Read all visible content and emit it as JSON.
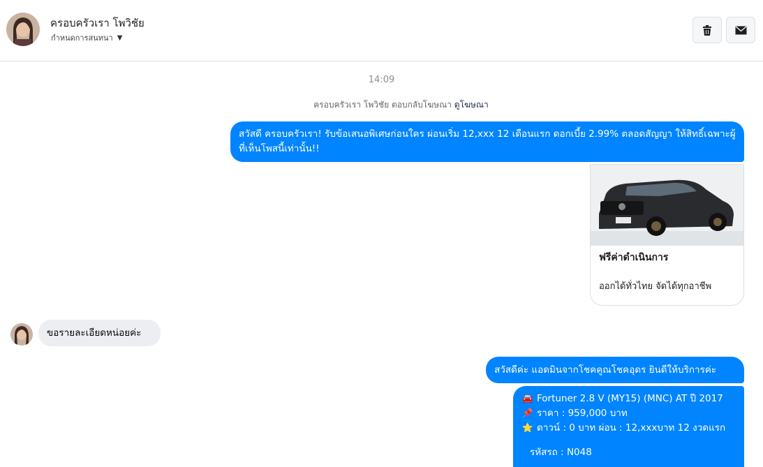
{
  "header": {
    "name": "ครอบครัวเรา โพวิชัย",
    "subtitle": "กำหนดการสนทนา",
    "delete_icon": "trash-icon",
    "mail_icon": "envelope-icon"
  },
  "conversation": {
    "timestamp": "14:09",
    "reply_note_prefix": "ครอบครัวเรา โพวิชัย ตอบกลับโฆษณา",
    "reply_note_link": "ดูโฆษณา",
    "messages": {
      "ad_text": "สวัสดี ครอบครัวเรา! รับข้อเสนอพิเศษก่อนใคร ผ่อนเริ่ม 12,xxx 12 เดือนแรก ดอกเบี้ย 2.99% ตลอดสัญญา ให้สิทธิ์เฉพาะผู้ที่เห็นโพสนี้เท่านั้น!!",
      "card_title": "ฟรีค่าดำเนินการ",
      "card_subtitle": "ออกได้ทั่วไทย จัดได้ทุกอาชีพ",
      "customer_message": "ขอรายละเอียดหน่อยค่ะ",
      "admin_greeting": "สวัสดีค่ะ แอดมินจากโชคคูณโชคอุดร ยินดีให้บริการค่ะ",
      "details": {
        "car_icon": "car-icon",
        "car": "Fortuner 2.8 V (MY15) (MNC) AT ปี 2017",
        "pin_icon": "pin-icon",
        "price": "ราคา : 959,000 บาท",
        "star_icon": "star-icon",
        "down": "ดาวน์ : 0 บาท ผ่อน : 12,xxxบาท 12 งวดแรก",
        "code": "รหัสรถ : N048"
      }
    }
  },
  "colors": {
    "outgoing_bubble": "#0084ff",
    "incoming_bubble": "#eceef1",
    "divider": "#dddfe2"
  }
}
